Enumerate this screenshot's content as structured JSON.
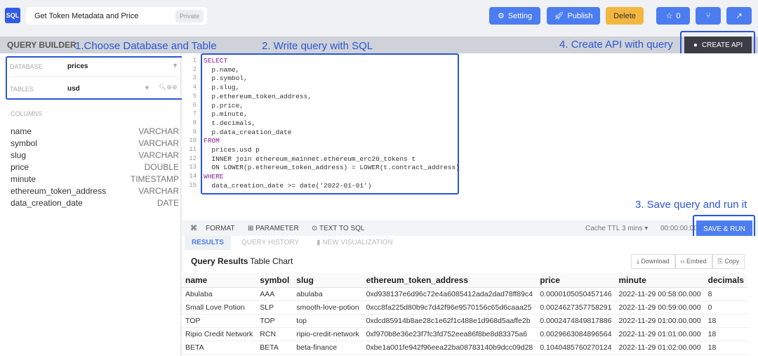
{
  "header": {
    "logo": "SQL",
    "title": "Get Token Metadata and Price",
    "visibility": "Private",
    "setting": "Setting",
    "publish": "Publish",
    "delete": "Delete",
    "stars": "0",
    "colors": {
      "primary": "#4c7df0",
      "delete": "#f3b63f"
    }
  },
  "query_builder": {
    "title": "QUERY BUILDER",
    "create_api": "CREATE API",
    "database_label": "DATABASE",
    "database_value": "prices",
    "tables_label": "TABLES",
    "tables_value": "usd",
    "columns_label": "COLUMNS",
    "columns": [
      {
        "name": "name",
        "type": "VARCHAR"
      },
      {
        "name": "symbol",
        "type": "VARCHAR"
      },
      {
        "name": "slug",
        "type": "VARCHAR"
      },
      {
        "name": "price",
        "type": "DOUBLE"
      },
      {
        "name": "minute",
        "type": "TIMESTAMP"
      },
      {
        "name": "ethereum_token_address",
        "type": "VARCHAR"
      },
      {
        "name": "data_creation_date",
        "type": "DATE"
      }
    ]
  },
  "annotations": {
    "step1": "1.Choose Database and Table",
    "step2": "2. Write query with SQL",
    "step3": "3. Save query and run it",
    "step4": "4. Create API with query"
  },
  "editor": {
    "lines": [
      "SELECT",
      "  p.name,",
      "  p.symbol,",
      "  p.slug,",
      "  p.ethereum_token_address,",
      "  p.price,",
      "  p.minute,",
      "  t.decimals,",
      "  p.data_creation_date",
      "FROM",
      "  prices.usd p",
      "  INNER join ethereum_mainnet.ethereum_erc20_tokens t",
      "  ON LOWER(p.ethereum_token_address) = LOWER(t.contract_address)",
      "WHERE",
      "  data_creation_date >= date('2022-01-01')"
    ]
  },
  "toolbar": {
    "cmd": "⌘",
    "format": "FORMAT",
    "parameter": "PARAMETER",
    "text_to_sql": "TEXT TO SQL",
    "cache_label": "Cache TTL",
    "cache_value": "3 mins",
    "timer": "00:00:00.00",
    "save_run": "SAVE & RUN"
  },
  "tabs": {
    "results": "RESULTS",
    "history": "QUERY HISTORY",
    "visualization": "NEW VISUALIZATION"
  },
  "results": {
    "title": "Query Results",
    "subtitle": "Table Chart",
    "download": "Download",
    "embed": "Embed",
    "copy": "Copy",
    "columns": [
      "name",
      "symbol",
      "slug",
      "ethereum_token_address",
      "price",
      "minute",
      "decimals"
    ],
    "rows": [
      [
        "Abulaba",
        "AAA",
        "abulaba",
        "0xd938137e6d96c72e4a6085412ada2dad78ff89c4",
        "0.0000105050457146",
        "2022-11-29 00:58:00.000",
        "8"
      ],
      [
        "Small Love Potion",
        "SLP",
        "smooth-love-potion",
        "0xcc8fa225d80b9c7d42f96e9570156c65d6caaa25",
        "0.0024627357758291",
        "2022-11-29 00:59:00.000",
        "0"
      ],
      [
        "TOP",
        "TOP",
        "top",
        "0xdcd85914b8ae28c1e62f1c488e1d968d5aaffe2b",
        "0.0002474849817886",
        "2022-11-29 01:00:00.000",
        "18"
      ],
      [
        "Ripio Credit Network",
        "RCN",
        "ripio-credit-network",
        "0xf970b8e36e23f7fc3fd752eea86f8be8d83375a6",
        "0.0029663084896564",
        "2022-11-29 01:01:00.000",
        "18"
      ],
      [
        "BETA",
        "BETA",
        "beta-finance",
        "0xbe1a001fe942f96eea22ba08783140b9dcc09d28",
        "0.1040485760270124",
        "2022-11-29 01:02:00.000",
        "18"
      ]
    ]
  }
}
